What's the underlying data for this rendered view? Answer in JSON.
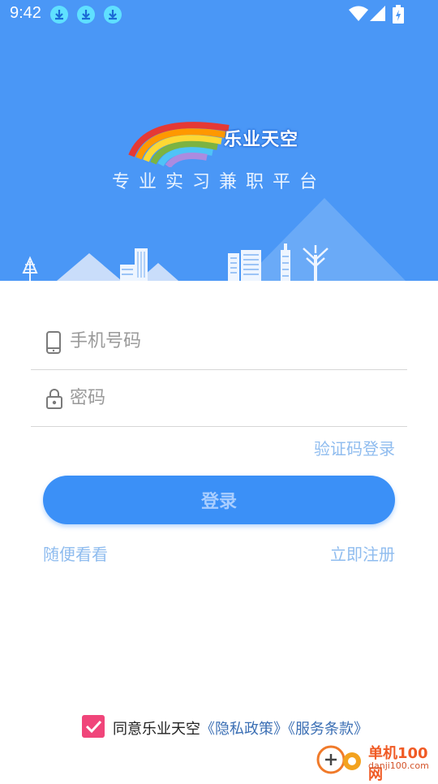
{
  "status_bar": {
    "time": "9:42",
    "download_icons": [
      "download-icon",
      "download-icon",
      "download-icon"
    ],
    "system_icons": [
      "wifi-icon",
      "signal-icon",
      "battery-charging-icon"
    ]
  },
  "header": {
    "brand_name": "乐业天空",
    "slogan": "专业实习兼职平台",
    "background_color": "#4a97f6"
  },
  "form": {
    "phone": {
      "placeholder": "手机号码",
      "value": "",
      "icon": "phone-icon"
    },
    "password": {
      "placeholder": "密码",
      "value": "",
      "icon": "lock-icon"
    },
    "code_login_link": "验证码登录",
    "login_button": "登录",
    "browse_link": "随便看看",
    "register_link": "立即注册",
    "accent_color": "#3b90f7"
  },
  "agreement": {
    "checked": true,
    "prefix": "同意乐业天空",
    "privacy_policy": "《隐私政策》",
    "terms": "《服务条款》"
  },
  "watermark": {
    "brand": "单机100网",
    "domain": "danji100.com"
  }
}
